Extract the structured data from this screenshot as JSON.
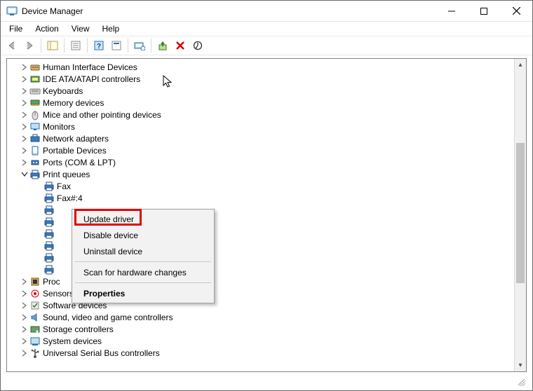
{
  "window": {
    "title": "Device Manager"
  },
  "menu": {
    "file": "File",
    "action": "Action",
    "view": "View",
    "help": "Help"
  },
  "tree": [
    {
      "label": "Human Interface Devices",
      "icon": "hid",
      "expand": "closed",
      "depth": 0
    },
    {
      "label": "IDE ATA/ATAPI controllers",
      "icon": "ide",
      "expand": "closed",
      "depth": 0
    },
    {
      "label": "Keyboards",
      "icon": "keyboard",
      "expand": "closed",
      "depth": 0
    },
    {
      "label": "Memory devices",
      "icon": "memory",
      "expand": "closed",
      "depth": 0
    },
    {
      "label": "Mice and other pointing devices",
      "icon": "mouse",
      "expand": "closed",
      "depth": 0
    },
    {
      "label": "Monitors",
      "icon": "monitor",
      "expand": "closed",
      "depth": 0
    },
    {
      "label": "Network adapters",
      "icon": "network",
      "expand": "closed",
      "depth": 0
    },
    {
      "label": "Portable Devices",
      "icon": "portable",
      "expand": "closed",
      "depth": 0
    },
    {
      "label": "Ports (COM & LPT)",
      "icon": "port",
      "expand": "closed",
      "depth": 0
    },
    {
      "label": "Print queues",
      "icon": "printer",
      "expand": "open",
      "depth": 0
    },
    {
      "label": "Fax",
      "icon": "printer",
      "expand": "none",
      "depth": 1
    },
    {
      "label": "Fax#:4",
      "icon": "printer",
      "expand": "none",
      "depth": 1
    },
    {
      "label": "",
      "icon": "printer",
      "expand": "none",
      "depth": 1
    },
    {
      "label": "",
      "icon": "printer",
      "expand": "none",
      "depth": 1
    },
    {
      "label": "",
      "icon": "printer",
      "expand": "none",
      "depth": 1
    },
    {
      "label": "",
      "icon": "printer",
      "expand": "none",
      "depth": 1
    },
    {
      "label": "",
      "icon": "printer",
      "expand": "none",
      "depth": 1
    },
    {
      "label": "",
      "icon": "printer",
      "expand": "none",
      "depth": 1
    },
    {
      "label": "Proc",
      "icon": "processor",
      "expand": "closed",
      "depth": 0
    },
    {
      "label": "Sensors",
      "icon": "sensor",
      "expand": "closed",
      "depth": 0
    },
    {
      "label": "Software devices",
      "icon": "software",
      "expand": "closed",
      "depth": 0
    },
    {
      "label": "Sound, video and game controllers",
      "icon": "sound",
      "expand": "closed",
      "depth": 0
    },
    {
      "label": "Storage controllers",
      "icon": "storage",
      "expand": "closed",
      "depth": 0
    },
    {
      "label": "System devices",
      "icon": "system",
      "expand": "closed",
      "depth": 0
    },
    {
      "label": "Universal Serial Bus controllers",
      "icon": "usb",
      "expand": "closed",
      "depth": 0
    }
  ],
  "context_menu": {
    "update_driver": "Update driver",
    "disable_device": "Disable device",
    "uninstall_device": "Uninstall device",
    "scan_hardware": "Scan for hardware changes",
    "properties": "Properties"
  }
}
